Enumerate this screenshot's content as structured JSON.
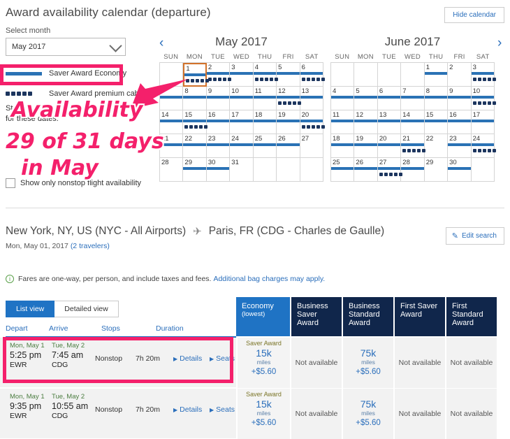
{
  "calendar": {
    "title": "Award availability calendar (departure)",
    "hide_button": "Hide calendar",
    "select_month_label": "Select month",
    "selected_month": "May 2017",
    "legend": {
      "economy": "Saver Award Economy",
      "premium": "Saver Award premium cabin",
      "note_line1": "St",
      "note_line2": "for these dates."
    },
    "nonstop_checkbox": "Show only nonstop flight availability",
    "prev_arrow": "‹",
    "next_arrow": "›",
    "dow": [
      "SUN",
      "MON",
      "TUE",
      "WED",
      "THU",
      "FRI",
      "SAT"
    ],
    "months": [
      {
        "name": "May 2017",
        "weeks": [
          [
            {
              "num": "",
              "empty": true
            },
            {
              "num": "1",
              "bar": true,
              "dots": true,
              "selected": true
            },
            {
              "num": "2",
              "bar": true,
              "dots": true
            },
            {
              "num": "3",
              "bar": true,
              "dots": false
            },
            {
              "num": "4",
              "bar": true,
              "dots": true
            },
            {
              "num": "5",
              "bar": true,
              "dots": false
            },
            {
              "num": "6",
              "bar": true,
              "dots": true
            }
          ],
          [
            {
              "num": "7",
              "bar": true,
              "dots": false
            },
            {
              "num": "8",
              "bar": true,
              "dots": false
            },
            {
              "num": "9",
              "bar": true,
              "dots": false
            },
            {
              "num": "10",
              "bar": true,
              "dots": false
            },
            {
              "num": "11",
              "bar": true,
              "dots": false
            },
            {
              "num": "12",
              "bar": true,
              "dots": true
            },
            {
              "num": "13",
              "bar": true,
              "dots": false
            }
          ],
          [
            {
              "num": "14",
              "bar": true,
              "dots": false
            },
            {
              "num": "15",
              "bar": true,
              "dots": true
            },
            {
              "num": "16",
              "bar": true,
              "dots": false
            },
            {
              "num": "17",
              "bar": true,
              "dots": false
            },
            {
              "num": "18",
              "bar": true,
              "dots": false
            },
            {
              "num": "19",
              "bar": true,
              "dots": false
            },
            {
              "num": "20",
              "bar": true,
              "dots": true
            }
          ],
          [
            {
              "num": "21",
              "bar": true,
              "dots": false
            },
            {
              "num": "22",
              "bar": true,
              "dots": false
            },
            {
              "num": "23",
              "bar": true,
              "dots": false
            },
            {
              "num": "24",
              "bar": true,
              "dots": false
            },
            {
              "num": "25",
              "bar": true,
              "dots": false
            },
            {
              "num": "26",
              "bar": true,
              "dots": false
            },
            {
              "num": "27",
              "bar": false,
              "dots": false
            }
          ],
          [
            {
              "num": "28",
              "bar": false,
              "dots": false
            },
            {
              "num": "29",
              "bar": true,
              "dots": false
            },
            {
              "num": "30",
              "bar": true,
              "dots": false
            },
            {
              "num": "31",
              "bar": false,
              "dots": false
            },
            {
              "num": "",
              "empty": true
            },
            {
              "num": "",
              "empty": true
            },
            {
              "num": "",
              "empty": true
            }
          ]
        ]
      },
      {
        "name": "June 2017",
        "weeks": [
          [
            {
              "num": "",
              "empty": true
            },
            {
              "num": "",
              "empty": true
            },
            {
              "num": "",
              "empty": true
            },
            {
              "num": "",
              "empty": true
            },
            {
              "num": "1",
              "bar": true,
              "dots": false
            },
            {
              "num": "2",
              "bar": false,
              "dots": false
            },
            {
              "num": "3",
              "bar": true,
              "dots": true
            }
          ],
          [
            {
              "num": "4",
              "bar": true,
              "dots": false
            },
            {
              "num": "5",
              "bar": true,
              "dots": false
            },
            {
              "num": "6",
              "bar": true,
              "dots": false
            },
            {
              "num": "7",
              "bar": true,
              "dots": false
            },
            {
              "num": "8",
              "bar": true,
              "dots": false
            },
            {
              "num": "9",
              "bar": true,
              "dots": false
            },
            {
              "num": "10",
              "bar": true,
              "dots": true
            }
          ],
          [
            {
              "num": "11",
              "bar": true,
              "dots": false
            },
            {
              "num": "12",
              "bar": true,
              "dots": false
            },
            {
              "num": "13",
              "bar": true,
              "dots": false
            },
            {
              "num": "14",
              "bar": true,
              "dots": false
            },
            {
              "num": "15",
              "bar": true,
              "dots": false
            },
            {
              "num": "16",
              "bar": true,
              "dots": false
            },
            {
              "num": "17",
              "bar": true,
              "dots": false
            }
          ],
          [
            {
              "num": "18",
              "bar": true,
              "dots": false
            },
            {
              "num": "19",
              "bar": true,
              "dots": false
            },
            {
              "num": "20",
              "bar": true,
              "dots": false
            },
            {
              "num": "21",
              "bar": true,
              "dots": true
            },
            {
              "num": "22",
              "bar": false,
              "dots": false
            },
            {
              "num": "23",
              "bar": true,
              "dots": false
            },
            {
              "num": "24",
              "bar": true,
              "dots": true
            }
          ],
          [
            {
              "num": "25",
              "bar": true,
              "dots": false
            },
            {
              "num": "26",
              "bar": true,
              "dots": false
            },
            {
              "num": "27",
              "bar": true,
              "dots": true
            },
            {
              "num": "28",
              "bar": true,
              "dots": false
            },
            {
              "num": "29",
              "bar": false,
              "dots": false
            },
            {
              "num": "30",
              "bar": true,
              "dots": false
            },
            {
              "num": "",
              "empty": true
            }
          ]
        ]
      }
    ]
  },
  "search": {
    "origin": "New York, NY, US (NYC - All Airports)",
    "plane_icon": "✈",
    "destination": "Paris, FR (CDG - Charles de Gaulle)",
    "date": "Mon, May 01, 2017 ",
    "travelers": "(2 travelers)",
    "edit_button": "Edit search",
    "pencil_icon": "✎",
    "fare_note": "Fares are one-way, per person, and include taxes and fees.",
    "bag_link": "Additional bag charges may apply.",
    "info_icon": "i"
  },
  "results": {
    "tabs": [
      {
        "label": "List view",
        "active": true
      },
      {
        "label": "Detailed view",
        "active": false
      }
    ],
    "columns": [
      "Depart",
      "Arrive",
      "Stops",
      "Duration"
    ],
    "fare_columns": [
      {
        "name": "Economy",
        "sub": "(lowest)",
        "highlight": true
      },
      {
        "name": "Business Saver Award",
        "sub": "",
        "highlight": false
      },
      {
        "name": "Business Standard Award",
        "sub": "",
        "highlight": false
      },
      {
        "name": "First Saver Award",
        "sub": "",
        "highlight": false
      },
      {
        "name": "First Standard Award",
        "sub": "",
        "highlight": false
      }
    ],
    "details_label": "Details",
    "seats_label": "Seats",
    "triangle_icon": "▶",
    "rows": [
      {
        "depart_day": "Mon, May 1",
        "depart_time": "5:25 pm",
        "depart_airport": "EWR",
        "arrive_day": "Tue, May 2",
        "arrive_time": "7:45 am",
        "arrive_airport": "CDG",
        "stops": "Nonstop",
        "duration": "7h 20m",
        "fares": [
          {
            "saver": "Saver Award",
            "miles": "15k",
            "unit": "miles",
            "money": "+$5.60",
            "available": true
          },
          {
            "text": "Not available",
            "available": false
          },
          {
            "saver": "",
            "miles": "75k",
            "unit": "miles",
            "money": "+$5.60",
            "available": true
          },
          {
            "text": "Not available",
            "available": false
          },
          {
            "text": "Not available",
            "available": false
          }
        ]
      },
      {
        "depart_day": "Mon, May 1",
        "depart_time": "9:35 pm",
        "depart_airport": "EWR",
        "arrive_day": "Tue, May 2",
        "arrive_time": "10:55 am",
        "arrive_airport": "CDG",
        "stops": "Nonstop",
        "duration": "7h 20m",
        "fares": [
          {
            "saver": "Saver Award",
            "miles": "15k",
            "unit": "miles",
            "money": "+$5.60",
            "available": true
          },
          {
            "text": "Not available",
            "available": false
          },
          {
            "saver": "",
            "miles": "75k",
            "unit": "miles",
            "money": "+$5.60",
            "available": true
          },
          {
            "text": "Not available",
            "available": false
          },
          {
            "text": "Not available",
            "available": false
          }
        ]
      }
    ]
  },
  "annotations": {
    "line1": "Availability",
    "line2": "29 of 31 days",
    "line3": "in May",
    "color": "#f4206b"
  }
}
